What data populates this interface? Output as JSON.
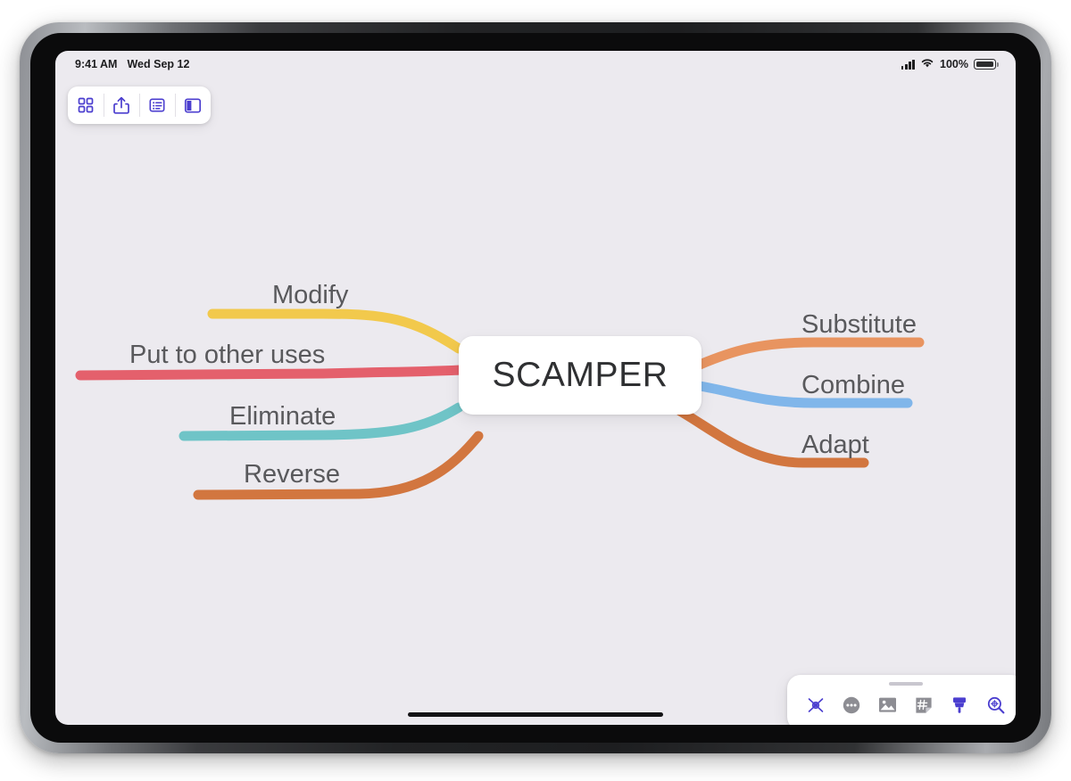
{
  "status_bar": {
    "time": "9:41 AM",
    "date": "Wed Sep 12",
    "battery_percent": "100%",
    "signal_icon": "cellular-signal-icon",
    "wifi_icon": "wifi-icon",
    "battery_icon": "battery-icon"
  },
  "top_toolbar": {
    "buttons": [
      {
        "name": "grid-view-button",
        "icon": "grid-icon",
        "label": "Grid"
      },
      {
        "name": "share-button",
        "icon": "share-icon",
        "label": "Share"
      },
      {
        "name": "outline-view-button",
        "icon": "outline-list-icon",
        "label": "Outline"
      },
      {
        "name": "sidebar-toggle-button",
        "icon": "sidebar-panel-icon",
        "label": "Sidebar"
      }
    ]
  },
  "mindmap": {
    "center": {
      "label": "SCAMPER"
    },
    "branches": [
      {
        "label": "Modify",
        "side": "left",
        "color": "#F2C94C"
      },
      {
        "label": "Put to other uses",
        "side": "left",
        "color": "#E4606C"
      },
      {
        "label": "Eliminate",
        "side": "left",
        "color": "#6FC4C7"
      },
      {
        "label": "Reverse",
        "side": "left",
        "color": "#D2763F"
      },
      {
        "label": "Substitute",
        "side": "right",
        "color": "#E89460"
      },
      {
        "label": "Combine",
        "side": "right",
        "color": "#80B6EA"
      },
      {
        "label": "Adapt",
        "side": "right",
        "color": "#D2763F"
      }
    ]
  },
  "bottom_toolbar": {
    "grabber": "drag-handle",
    "buttons": [
      {
        "name": "collapse-node-button",
        "icon": "collapse-node-icon"
      },
      {
        "name": "more-options-button",
        "icon": "more-dots-icon"
      },
      {
        "name": "insert-image-button",
        "icon": "image-icon"
      },
      {
        "name": "insert-sticker-button",
        "icon": "sticker-note-icon"
      },
      {
        "name": "style-brush-button",
        "icon": "paintbrush-icon"
      },
      {
        "name": "zoom-button",
        "icon": "magnifier-icon"
      }
    ]
  },
  "colors": {
    "accent": "#4b3ecf",
    "canvas_bg": "#eceaef",
    "node_bg": "#ffffff",
    "label_text": "#59595c"
  }
}
